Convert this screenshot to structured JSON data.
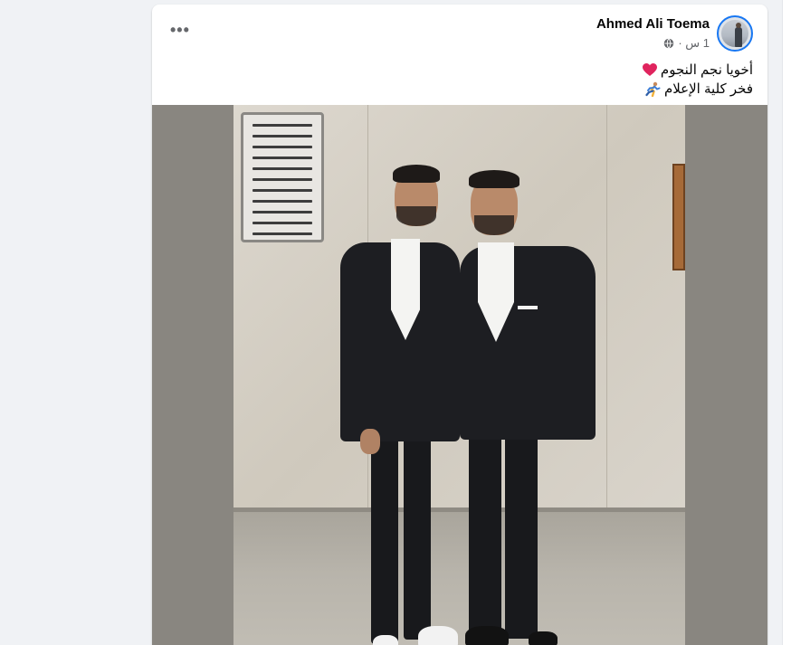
{
  "post": {
    "author": "Ahmed Ali Toema",
    "time": "1 س ·",
    "privacy_icon": "globe-icon",
    "more_label": "•••",
    "lines": [
      {
        "text": "أخويا نجم النجوم",
        "emoji": "heart-icon"
      },
      {
        "text": "فخر كلية الإعلام",
        "emoji": "runner-icon"
      }
    ]
  },
  "colors": {
    "accent": "#1877f2",
    "meta_text": "#65676b",
    "body_text": "#050505",
    "heart": "#e0245e"
  }
}
